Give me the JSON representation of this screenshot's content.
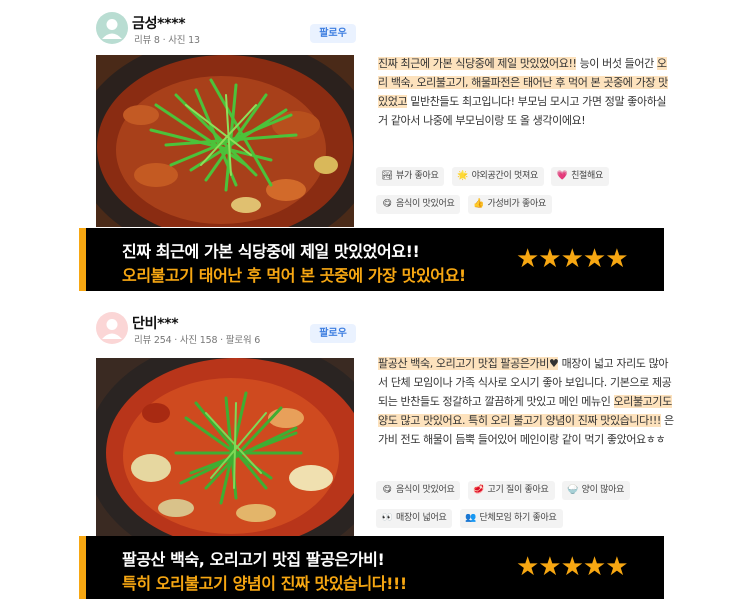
{
  "reviews": [
    {
      "user": {
        "name": "금성****",
        "stats": "리뷰 8 · 사진 13",
        "avatar_color": "#b9ddd2"
      },
      "follow_label": "팔로우",
      "text_parts": [
        {
          "t": "진짜 최근에 가본 식당중에 제일 맛있었어요!!",
          "hl": true
        },
        {
          "t": " 능이 버섯 들어간 ",
          "hl": false
        },
        {
          "t": "오리 백숙, 오리불고기, 해물파전은 태어난 후 먹어 본 곳중에 가장 맛있었고",
          "hl": true
        },
        {
          "t": " 밑반찬들도 최고입니다! 부모님 모시고 가면 정말 좋아하실거 같아서 나중에 부모님이랑 또 올 생각이에요!",
          "hl": false
        }
      ],
      "tags": [
        {
          "icon": "🏞",
          "icon_name": "view-icon",
          "label": "뷰가 좋아요"
        },
        {
          "icon": "🌟",
          "icon_name": "sparkle-icon",
          "label": "야외공간이 멋져요"
        },
        {
          "icon": "💗",
          "icon_name": "heart-icon",
          "label": "친절해요"
        },
        {
          "icon": "😋",
          "icon_name": "yummy-face-icon",
          "label": "음식이 맛있어요"
        },
        {
          "icon": "👍",
          "icon_name": "thumbs-up-icon",
          "label": "가성비가 좋아요"
        }
      ],
      "banner": {
        "line1": "진짜 최근에 가본 식당중에 제일 맛있었어요!!",
        "line2": "오리불고기 태어난 후 먹어 본 곳중에 가장 맛있어요!",
        "rating": 5,
        "stars": "★★★★★"
      }
    },
    {
      "user": {
        "name": "단비***",
        "stats": "리뷰 254 · 사진 158 · 팔로워 6",
        "avatar_color": "#fbd6d6"
      },
      "follow_label": "팔로우",
      "text_parts": [
        {
          "t": "팔공산 백숙, 오리고기 맛집 팔공은가비♥",
          "hl": true
        },
        {
          "t": " 매장이 넓고 자리도 많아서 단체 모임이나 가족 식사로 오시기 좋아 보입니다. 기본으로 제공되는 반찬들도 정갈하고 깔끔하게 맛있고 메인 메뉴인 ",
          "hl": false
        },
        {
          "t": "오리불고기도 양도 많고 맛있어요. 특히 오리 불고기 양념이 진짜 맛있습니다!!!",
          "hl": true
        },
        {
          "t": " 은가비 전도 해물이 듬뿍 들어있어 메인이랑 같이 먹기 좋았어요ㅎㅎ",
          "hl": false
        }
      ],
      "tags": [
        {
          "icon": "😋",
          "icon_name": "yummy-face-icon",
          "label": "음식이 맛있어요"
        },
        {
          "icon": "🥩",
          "icon_name": "meat-icon",
          "label": "고기 질이 좋아요"
        },
        {
          "icon": "🍚",
          "icon_name": "rice-bowl-icon",
          "label": "양이 많아요"
        },
        {
          "icon": "👀",
          "icon_name": "eyes-icon",
          "label": "매장이 넓어요"
        },
        {
          "icon": "👥",
          "icon_name": "group-icon",
          "label": "단체모임 하기 좋아요"
        }
      ],
      "banner": {
        "line1": "팔공산 백숙, 오리고기 맛집 팔공은가비!",
        "line2": "특히 오리불고기 양념이 진짜 맛있습니다!!!",
        "rating": 5,
        "stars": "★★★★★"
      }
    }
  ],
  "colors": {
    "accent": "#f7a712",
    "highlight": "#fde2bd",
    "follow_text": "#3f7fe0",
    "follow_bg": "#eaf2ff"
  }
}
